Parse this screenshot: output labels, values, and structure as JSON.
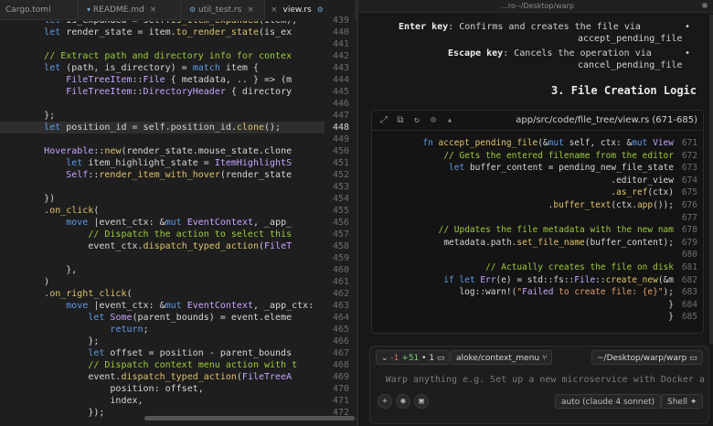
{
  "tabs": [
    {
      "label": "Cargo.toml",
      "active": false
    },
    {
      "label": "README.md",
      "active": false
    },
    {
      "label": "util_test.rs",
      "active": false
    },
    {
      "label": "view.rs",
      "active": true
    }
  ],
  "editor": {
    "lines": [
      {
        "n": "439",
        "code": "        let is_expanded = self.is_item_expanded(item);"
      },
      {
        "n": "440",
        "code": "        let render_state = item.to_render_state(is_ex"
      },
      {
        "n": "441",
        "code": ""
      },
      {
        "n": "442",
        "code": "        // Extract path and directory info for contex"
      },
      {
        "n": "443",
        "code": "        let (path, is_directory) = match item {"
      },
      {
        "n": "444",
        "code": "            FileTreeItem::File { metadata, .. } => (m"
      },
      {
        "n": "445",
        "code": "            FileTreeItem::DirectoryHeader { directory"
      },
      {
        "n": "446",
        "code": ""
      },
      {
        "n": "447",
        "code": "        };"
      },
      {
        "n": "448",
        "code": "        let position_id = self.position_id.clone();",
        "current": true
      },
      {
        "n": "449",
        "code": ""
      },
      {
        "n": "450",
        "code": "        Hoverable::new(render_state.mouse_state.clone"
      },
      {
        "n": "451",
        "code": "            let item_highlight_state = ItemHighlightS"
      },
      {
        "n": "452",
        "code": "            Self::render_item_with_hover(render_state"
      },
      {
        "n": "453",
        "code": ""
      },
      {
        "n": "454",
        "code": "        })"
      },
      {
        "n": "455",
        "code": "        .on_click("
      },
      {
        "n": "456",
        "code": "            move |event_ctx: &mut EventContext, _app_"
      },
      {
        "n": "457",
        "code": "                // Dispatch the action to select this"
      },
      {
        "n": "458",
        "code": "                event_ctx.dispatch_typed_action(FileT"
      },
      {
        "n": "459",
        "code": ""
      },
      {
        "n": "460",
        "code": "            },"
      },
      {
        "n": "461",
        "code": "        )"
      },
      {
        "n": "462",
        "code": "        .on_right_click("
      },
      {
        "n": "463",
        "code": "            move |event_ctx: &mut EventContext, _app_ctx:"
      },
      {
        "n": "464",
        "code": "                let Some(parent_bounds) = event.eleme"
      },
      {
        "n": "465",
        "code": "                    return;"
      },
      {
        "n": "466",
        "code": "                };"
      },
      {
        "n": "467",
        "code": "                let offset = position - parent_bounds"
      },
      {
        "n": "468",
        "code": "                // Dispatch context menu action with t"
      },
      {
        "n": "469",
        "code": "                event.dispatch_typed_action(FileTreeA"
      },
      {
        "n": "470",
        "code": "                    position: offset,"
      },
      {
        "n": "471",
        "code": "                    index,"
      },
      {
        "n": "472",
        "code": "                });"
      }
    ]
  },
  "right": {
    "window_title": "...ro--/Desktop/warp",
    "bullets": [
      {
        "term": "Enter key",
        "text": ": Confirms and creates the file via",
        "fn": "accept_pending_file"
      },
      {
        "term": "Escape key",
        "text": ": Cancels the operation via",
        "fn": "cancel_pending_file"
      }
    ],
    "heading": "3. File Creation Logic",
    "codeblock": {
      "path": "app/src/code/file_tree/view.rs (671-685)",
      "lines": [
        {
          "n": "671",
          "code": "    fn accept_pending_file(&mut self, ctx: &mut View"
        },
        {
          "n": "672",
          "code": "        // Gets the entered filename from the editor"
        },
        {
          "n": "673",
          "code": "        let buffer_content = pending_new_file_state"
        },
        {
          "n": "674",
          "code": "            .editor_view"
        },
        {
          "n": "675",
          "code": "            .as_ref(ctx)"
        },
        {
          "n": "676",
          "code": "            .buffer_text(ctx.app());"
        },
        {
          "n": "677",
          "code": ""
        },
        {
          "n": "678",
          "code": "        // Updates the file metadata with the new nam"
        },
        {
          "n": "679",
          "code": "        metadata.path.set_file_name(buffer_content);"
        },
        {
          "n": "680",
          "code": ""
        },
        {
          "n": "681",
          "code": "        // Actually creates the file on disk"
        },
        {
          "n": "682",
          "code": "        if let Err(e) = std::fs::File::create_new(&m"
        },
        {
          "n": "683",
          "code": "            log::warn!(\"Failed to create file: {e}\");"
        },
        {
          "n": "684",
          "code": "        }"
        },
        {
          "n": "685",
          "code": "    }"
        }
      ]
    },
    "input": {
      "path_chip": "~/Desktop/warp/warp",
      "branch_chip": "aloke/context_menu",
      "diff_files": "1",
      "diff_add": "+51",
      "diff_del": "-1",
      "placeholder": "Warp anything e.g. Set up a new microservice with Docker a",
      "model": "auto (claude 4 sonnet)",
      "shell": "Shell"
    }
  }
}
